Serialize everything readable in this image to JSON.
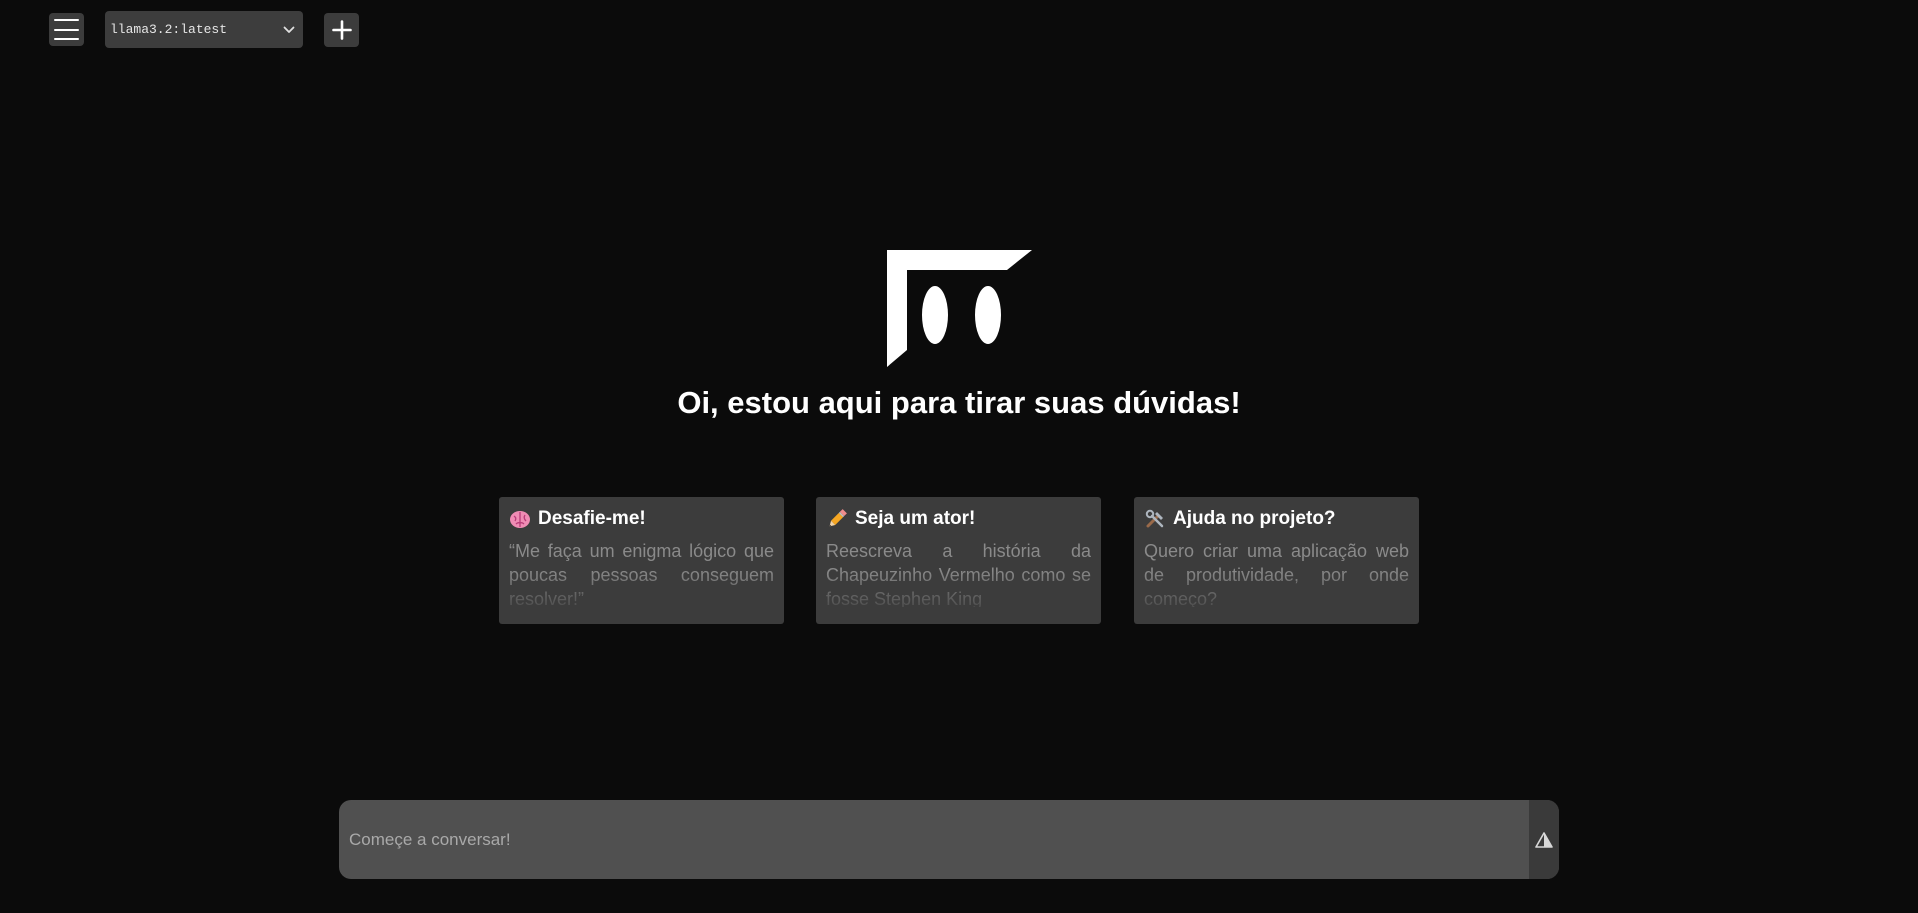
{
  "header": {
    "menu_icon": "hamburger-menu-icon",
    "model_select": {
      "value": "llama3.2:latest",
      "icon": "chevron-down-icon"
    },
    "new_chat_icon": "plus-icon"
  },
  "hero": {
    "logo": "assistant-logo",
    "greeting": "Oi, estou aqui para tirar suas dúvidas!"
  },
  "cards": [
    {
      "icon": "brain-icon",
      "title": "Desafie-me!",
      "body": "“Me faça um enigma lógico que poucas pessoas conseguem resolver!”"
    },
    {
      "icon": "pencil-icon",
      "title": "Seja um ator!",
      "body": "Reescreva a história da Chapeuzinho Vermelho como se fosse Stephen King"
    },
    {
      "icon": "tools-icon",
      "title": "Ajuda no projeto?",
      "body": "Quero criar uma aplicação web de produtividade, por onde começo?"
    }
  ],
  "chat_input": {
    "placeholder": "Começe a conversar!",
    "send_icon": "send-icon"
  },
  "colors": {
    "background": "#0b0b0b",
    "panel": "#3c3c3c",
    "input": "#505050",
    "muted_text": "#8a8a8a"
  }
}
